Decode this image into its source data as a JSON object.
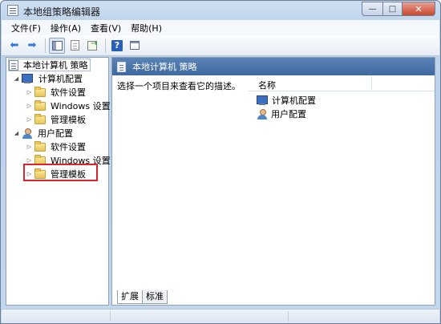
{
  "window": {
    "title": "本地组策略编辑器"
  },
  "caption": {
    "minimize": "—",
    "maximize": "□",
    "close": "✕"
  },
  "menu": [
    "文件(F)",
    "操作(A)",
    "查看(V)",
    "帮助(H)"
  ],
  "toolbar": {
    "back_icon": "arrow-left-icon",
    "forward_icon": "arrow-right-icon",
    "help_label": "?"
  },
  "tree": {
    "root": "本地计算机 策略",
    "computer_config": "计算机配置",
    "computer_children": [
      "软件设置",
      "Windows 设置",
      "管理模板"
    ],
    "user_config": "用户配置",
    "user_children": [
      "软件设置",
      "Windows 设置",
      "管理模板"
    ]
  },
  "right": {
    "header": "本地计算机 策略",
    "description": "选择一个项目来查看它的描述。",
    "column_name": "名称",
    "items": [
      "计算机配置",
      "用户配置"
    ]
  },
  "tabs": [
    "扩展",
    "标准"
  ],
  "colors": {
    "accent_header": "#4a74a8",
    "highlight_box": "#d9232d"
  }
}
